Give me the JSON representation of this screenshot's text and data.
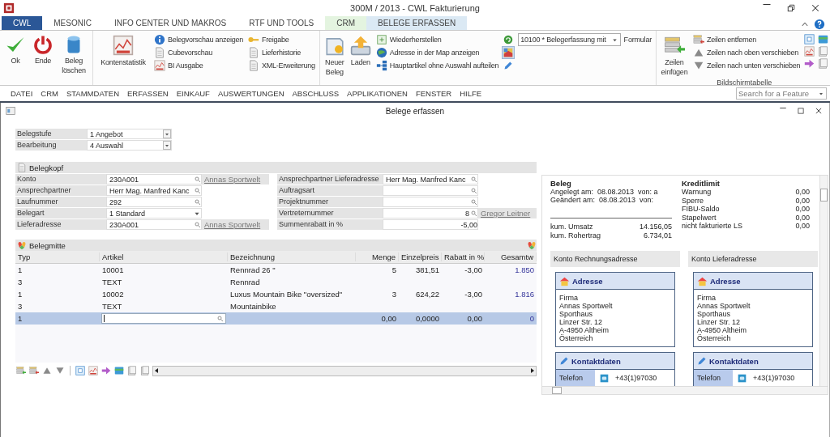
{
  "window": {
    "title": "300M / 2013 - CWL Fakturierung"
  },
  "ribbon": {
    "tabs": [
      {
        "label": "CWL",
        "selected": true
      },
      {
        "label": "MESONIC",
        "selected": false
      },
      {
        "label": "INFO CENTER UND MAKROS",
        "selected": false
      },
      {
        "label": "RTF UND TOOLS",
        "selected": false
      },
      {
        "label": "CRM",
        "selected": false,
        "color": "#e4f4e0"
      },
      {
        "label": "BELEGE ERFASSEN",
        "selected": false,
        "color": "#dbe9f4"
      }
    ],
    "actions": [
      {
        "label": "Ok"
      },
      {
        "label": "Ende"
      },
      {
        "label": "Beleg löschen"
      }
    ],
    "statistics": {
      "label": "Kontenstatistik"
    },
    "preview_items": [
      {
        "label": "Belegvorschau anzeigen"
      },
      {
        "label": "Cubevorschau"
      },
      {
        "label": "BI Ausgabe"
      }
    ],
    "release_items": [
      {
        "label": "Freigabe"
      },
      {
        "label": "Lieferhistorie"
      },
      {
        "label": "XML-Erweiterung"
      }
    ],
    "document_actions": [
      {
        "label": "Neuer Beleg"
      },
      {
        "label": "Laden"
      }
    ],
    "document_items": [
      {
        "label": "Wiederherstellen"
      },
      {
        "label": "Adresse in der Map anzeigen"
      },
      {
        "label": "Hauptartikel ohne Auswahl aufteilen"
      }
    ],
    "tool_buttons": [
      {
        "pressed": false
      },
      {
        "pressed": true
      },
      {
        "pressed": false
      }
    ],
    "form": {
      "value": "10100 * Belegerfassung mit",
      "label": "Formular"
    },
    "rows_group": {
      "title": "Bildschirmtabelle",
      "insert": "Zeilen einfügen",
      "items": [
        {
          "label": "Zeilen entfernen"
        },
        {
          "label": "Zeilen nach oben verschieben"
        },
        {
          "label": "Zeilen nach unten verschieben"
        }
      ]
    }
  },
  "menubar": {
    "items": [
      "DATEI",
      "CRM",
      "STAMMDATEN",
      "ERFASSEN",
      "EINKAUF",
      "AUSWERTUNGEN",
      "ABSCHLUSS",
      "APPLIKATIONEN",
      "FENSTER",
      "HILFE"
    ],
    "search": {
      "placeholder": "Search for a Feature"
    }
  },
  "document": {
    "title": "Belege erfassen",
    "stage_fields": [
      {
        "label": "Belegstufe",
        "value": "1 Angebot"
      },
      {
        "label": "Bearbeitung",
        "value": "4 Auswahl"
      }
    ],
    "header": {
      "title": "Belegkopf",
      "left_fields": [
        {
          "label": "Konto",
          "value": "230A001",
          "kind": "lookup",
          "link": "Annas Sportwelt"
        },
        {
          "label": "Ansprechpartner",
          "value": "Herr Mag. Manfred Kanc",
          "kind": "lookup"
        },
        {
          "label": "Laufnummer",
          "value": "292",
          "kind": "lookup"
        },
        {
          "label": "Belegart",
          "value": "1 Standard",
          "kind": "select"
        },
        {
          "label": "Lieferadresse",
          "value": "230A001",
          "kind": "lookup",
          "link": "Annas Sportwelt"
        }
      ],
      "right_fields": [
        {
          "label": "Ansprechpartner Lieferadresse",
          "value": "Herr Mag. Manfred Kanc",
          "kind": "lookup"
        },
        {
          "label": "Auftragsart",
          "kind": "lookup"
        },
        {
          "label": "Projektnummer",
          "kind": "lookup"
        },
        {
          "label": "Vertreternummer",
          "value": "8",
          "kind": "lookup-number",
          "link": "Gregor Leitner"
        },
        {
          "label": "Summenrabatt in %",
          "value": "-5,00",
          "kind": "number"
        }
      ]
    },
    "lines": {
      "title": "Belegmitte",
      "columns": [
        "Typ",
        "Artikel",
        "Bezeichnung",
        "Menge",
        "Einzelpreis",
        "Rabatt in %",
        "Gesamtw"
      ],
      "rows": [
        {
          "selected": false,
          "editing": false,
          "typ": "1",
          "artikel": "10001",
          "bezeichnung": "Rennrad 26 \"",
          "menge": "5",
          "einzelpreis": "381,51",
          "rabatt": "-3,00",
          "gesamtw": "1.850"
        },
        {
          "selected": false,
          "editing": false,
          "typ": "3",
          "artikel": "TEXT",
          "bezeichnung": "Rennrad"
        },
        {
          "selected": false,
          "editing": false,
          "typ": "1",
          "artikel": "10002",
          "bezeichnung": "Luxus Mountain Bike \"oversized\"",
          "menge": "3",
          "einzelpreis": "624,22",
          "rabatt": "-3,00",
          "gesamtw": "1.816"
        },
        {
          "selected": false,
          "editing": false,
          "typ": "3",
          "artikel": "TEXT",
          "bezeichnung": "Mountainbike"
        },
        {
          "selected": true,
          "editing": true,
          "typ": "1",
          "menge": "0,00",
          "einzelpreis": "0,0000",
          "rabatt": "0,00",
          "gesamtw": "0"
        }
      ]
    }
  },
  "info_panel": {
    "beleg": {
      "title": "Beleg",
      "entries": [
        {
          "label": "Angelegt am:",
          "date": "08.08.2013",
          "by": "von: a"
        },
        {
          "label": "Geändert am:",
          "date": "08.08.2013",
          "by": "von:"
        }
      ],
      "totals": [
        {
          "label": "kum. Umsatz",
          "value": "14.156,05"
        },
        {
          "label": "kum. Rohertrag",
          "value": "6.734,01"
        }
      ]
    },
    "credit": {
      "title": "Kreditlimit",
      "rows": [
        {
          "label": "Warnung",
          "value": "0,00"
        },
        {
          "label": "Sperre",
          "value": "0,00"
        },
        {
          "label": "FIBU-Saldo",
          "value": "0,00"
        },
        {
          "label": "Stapelwert",
          "value": "0,00"
        },
        {
          "label": "nicht fakturierte LS",
          "value": "0,00"
        }
      ]
    },
    "addresses": [
      {
        "title": "Konto Rechnungsadresse",
        "address_title": "Adresse",
        "lines": [
          "Firma",
          "Annas Sportwelt",
          "Sporthaus",
          "Linzer Str. 12",
          "A-4950 Altheim",
          "Österreich"
        ],
        "contact_title": "Kontaktdaten",
        "contacts": [
          {
            "label": "Telefon",
            "value": "+43(1)97030"
          }
        ]
      },
      {
        "title": "Konto Lieferadresse",
        "address_title": "Adresse",
        "lines": [
          "Firma",
          "Annas Sportwelt",
          "Sporthaus",
          "Linzer Str. 12",
          "A-4950 Altheim",
          "Österreich"
        ],
        "contact_title": "Kontaktdaten",
        "contacts": [
          {
            "label": "Telefon",
            "value": "+43(1)97030"
          }
        ]
      }
    ]
  }
}
